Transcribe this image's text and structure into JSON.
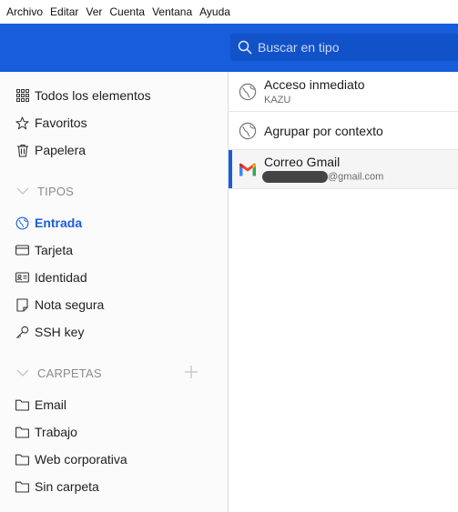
{
  "menubar": {
    "items": [
      "Archivo",
      "Editar",
      "Ver",
      "Cuenta",
      "Ventana",
      "Ayuda"
    ]
  },
  "search": {
    "placeholder": "Buscar en tipo"
  },
  "sidebar": {
    "all_items": "Todos los elementos",
    "favorites": "Favoritos",
    "trash": "Papelera",
    "types_header": "TIPOS",
    "types": [
      "Entrada",
      "Tarjeta",
      "Identidad",
      "Nota segura",
      "SSH key"
    ],
    "folders_header": "CARPETAS",
    "folders": [
      "Email",
      "Trabajo",
      "Web corporativa",
      "Sin carpeta"
    ]
  },
  "items": [
    {
      "title": "Acceso inmediato",
      "subtitle": "KAZU",
      "icon": "globe-icon"
    },
    {
      "title": "Agrupar por contexto",
      "subtitle": "",
      "icon": "globe-icon"
    },
    {
      "title": "Correo Gmail",
      "subtitle": "@gmail.com",
      "icon": "gmail-icon"
    }
  ],
  "colors": {
    "accent": "#175ddc",
    "header": "#175ddc",
    "search_bg": "#1252c8"
  }
}
